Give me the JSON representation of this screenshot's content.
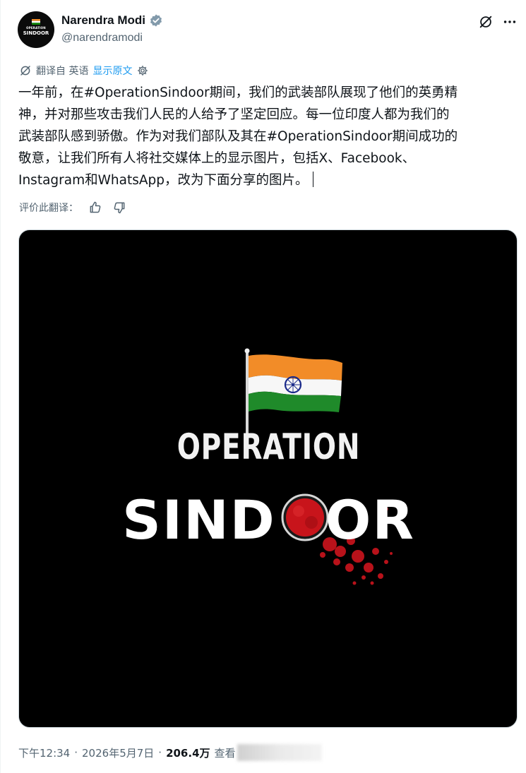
{
  "author": {
    "display_name": "Narendra Modi",
    "handle": "@narendramodi",
    "avatar_text_top": "OPERATION",
    "avatar_text_bottom": "SINDOOR"
  },
  "translation": {
    "label": "翻译自 英语",
    "show_original": "显示原文"
  },
  "tweet": {
    "lines": [
      "一年前，在#OperationSindoor期间，我们的武装部队展现了他们的英勇精",
      "神，并对那些攻击我们人民的人给予了坚定回应。每一位印度人都为我们的",
      "武装部队感到骄傲。作为对我们部队及其在#OperationSindoor期间成功的",
      "敬意，让我们所有人将社交媒体上的显示图片，包括X、Facebook、",
      "Instagram和WhatsApp，改为下面分享的图片。"
    ]
  },
  "rating": {
    "label": "评价此翻译："
  },
  "media": {
    "line1": "OPERATION",
    "line2_left": "SIND",
    "line2_right": "OR"
  },
  "meta": {
    "time": "下午12:34",
    "sep1": "·",
    "date": "2026年5月7日",
    "sep2": "·",
    "views": "206.4万",
    "views_suffix": "查看"
  },
  "icons": {
    "verified": "verified-badge-icon",
    "grok": "grok-icon",
    "more": "more-icon",
    "translate": "translate-icon",
    "settings": "gear-icon",
    "thumbs_up": "thumbs-up-icon",
    "thumbs_down": "thumbs-down-icon"
  },
  "colors": {
    "link": "#1d9bf0",
    "secondary": "#536471",
    "saffron": "#f28c28",
    "green": "#138808",
    "chakra": "#1a2a8a",
    "sindoor_red": "#c8141b"
  }
}
